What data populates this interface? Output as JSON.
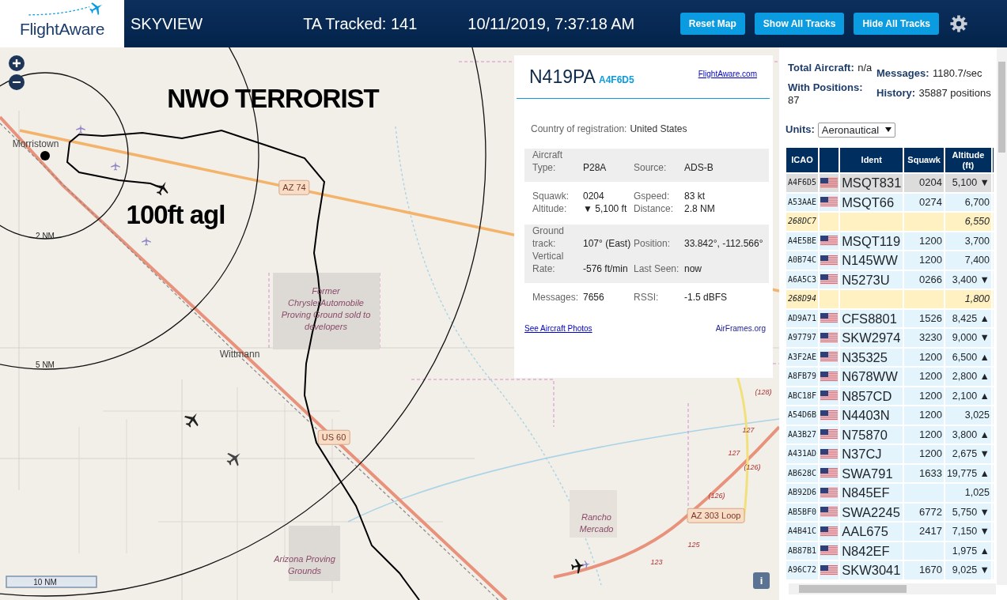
{
  "header": {
    "logo": "FlightAware",
    "title": "SKYVIEW",
    "tracked": "TA Tracked: 141",
    "datetime": "10/11/2019, 7:37:18 AM",
    "buttons": [
      "Reset Map",
      "Show All Tracks",
      "Hide All Tracks"
    ]
  },
  "map": {
    "labels": [
      {
        "kind": "annotation",
        "text": "NWO TERRORIST"
      },
      {
        "kind": "annotation",
        "text": "100ft agl"
      },
      {
        "kind": "place",
        "text": "Morristown"
      },
      {
        "kind": "ring",
        "text": "2 NM"
      },
      {
        "kind": "ring",
        "text": "5 NM"
      },
      {
        "kind": "shield",
        "text": "AZ 74"
      },
      {
        "kind": "area",
        "text": "Former ChryslerAutomobile Proving Ground sold to developers"
      },
      {
        "kind": "place",
        "text": "Wittmann"
      },
      {
        "kind": "shield",
        "text": "US 60"
      },
      {
        "kind": "area",
        "text": "Rancho Mercado"
      },
      {
        "kind": "shield",
        "text": "AZ 303 Loop"
      },
      {
        "kind": "area",
        "text": "Arizona Proving Grounds"
      },
      {
        "kind": "route",
        "text": "(128)"
      },
      {
        "kind": "route",
        "text": "127"
      },
      {
        "kind": "route",
        "text": "127"
      },
      {
        "kind": "route",
        "text": "(126)"
      },
      {
        "kind": "route",
        "text": "(126)"
      },
      {
        "kind": "route",
        "text": "125"
      },
      {
        "kind": "route",
        "text": "123"
      }
    ],
    "scale": "10 NM",
    "info_button": "i"
  },
  "info_panel": {
    "registration": "N419PA",
    "icao": "A4F6D5",
    "link": "FlightAware.com",
    "country_label": "Country of registration:",
    "country": "United States",
    "sections": [
      {
        "shaded": true,
        "rows": [
          [
            "Aircraft Type:",
            "P28A",
            "Source:",
            "ADS-B"
          ]
        ]
      },
      {
        "shaded": false,
        "rows": [
          [
            "Squawk:",
            "0204",
            "Gspeed:",
            "83 kt"
          ],
          [
            "Altitude:",
            "▼ 5,100 ft",
            "Distance:",
            "2.8 NM"
          ]
        ]
      },
      {
        "shaded": true,
        "rows": [
          [
            "Ground track:",
            "107° (East)",
            "Position:",
            "33.842°, -112.566°"
          ],
          [
            "Vertical Rate:",
            "-576 ft/min",
            "Last Seen:",
            "now"
          ]
        ]
      },
      {
        "shaded": false,
        "rows": [
          [
            "Messages:",
            "7656",
            "RSSI:",
            "-1.5 dBFS"
          ]
        ]
      }
    ],
    "photos_link": "See Aircraft Photos",
    "airframes_link": "AirFrames.org"
  },
  "stats": [
    {
      "label": "Total Aircraft:",
      "value": "n/a"
    },
    {
      "label": "Messages:",
      "value": "1180.7/sec"
    },
    {
      "label": "With Positions:",
      "value": "87"
    },
    {
      "label": "History:",
      "value": "35887 positions"
    }
  ],
  "units": {
    "label": "Units:",
    "value": "Aeronautical"
  },
  "table": {
    "columns": [
      "ICAO",
      "Ident",
      "Squawk",
      "Altitude (ft)"
    ],
    "rows": [
      {
        "icao": "A4F6D5",
        "flag": true,
        "ident": "MSQT831",
        "squawk": "0204",
        "altitude": "5,100",
        "trend": "▼",
        "selected": true,
        "positioned": true
      },
      {
        "icao": "A53AAE",
        "flag": true,
        "ident": "MSQT66",
        "squawk": "0274",
        "altitude": "6,700",
        "selected": false,
        "positioned": true
      },
      {
        "icao": "268DC7",
        "flag": false,
        "altitude": "6,550",
        "selected": false,
        "positioned": false
      },
      {
        "icao": "A4E5BE",
        "flag": true,
        "ident": "MSQT119",
        "squawk": "1200",
        "altitude": "3,700",
        "selected": false,
        "positioned": true
      },
      {
        "icao": "A0B74C",
        "flag": true,
        "ident": "N145WW",
        "squawk": "1200",
        "altitude": "7,400",
        "selected": false,
        "positioned": true
      },
      {
        "icao": "A6A5C3",
        "flag": true,
        "ident": "N5273U",
        "squawk": "0266",
        "altitude": "3,400",
        "trend": "▼",
        "selected": false,
        "positioned": true
      },
      {
        "icao": "268D94",
        "flag": false,
        "altitude": "1,800",
        "selected": false,
        "positioned": false
      },
      {
        "icao": "AD9A71",
        "flag": true,
        "ident": "CFS8801",
        "squawk": "1526",
        "altitude": "8,425",
        "trend": "▲",
        "selected": false,
        "positioned": true
      },
      {
        "icao": "A97797",
        "flag": true,
        "ident": "SKW2974",
        "squawk": "3230",
        "altitude": "9,000",
        "trend": "▼",
        "selected": false,
        "positioned": true
      },
      {
        "icao": "A3F2AE",
        "flag": true,
        "ident": "N35325",
        "squawk": "1200",
        "altitude": "6,500",
        "trend": "▲",
        "selected": false,
        "positioned": true
      },
      {
        "icao": "A8FB79",
        "flag": true,
        "ident": "N678WW",
        "squawk": "1200",
        "altitude": "2,800",
        "trend": "▲",
        "selected": false,
        "positioned": true
      },
      {
        "icao": "ABC18F",
        "flag": true,
        "ident": "N857CD",
        "squawk": "1200",
        "altitude": "2,100",
        "trend": "▲",
        "selected": false,
        "positioned": true
      },
      {
        "icao": "A54D6B",
        "flag": true,
        "ident": "N4403N",
        "squawk": "1200",
        "altitude": "3,025",
        "selected": false,
        "positioned": true
      },
      {
        "icao": "AA3B27",
        "flag": true,
        "ident": "N75870",
        "squawk": "1200",
        "altitude": "3,800",
        "trend": "▲",
        "selected": false,
        "positioned": true
      },
      {
        "icao": "A431AD",
        "flag": true,
        "ident": "N37CJ",
        "squawk": "1200",
        "altitude": "2,675",
        "trend": "▼",
        "selected": false,
        "positioned": true
      },
      {
        "icao": "AB628C",
        "flag": true,
        "ident": "SWA791",
        "squawk": "1633",
        "altitude": "19,775",
        "trend": "▲",
        "selected": false,
        "positioned": true
      },
      {
        "icao": "AB92D6",
        "flag": true,
        "ident": "N845EF",
        "altitude": "1,025",
        "selected": false,
        "positioned": true
      },
      {
        "icao": "AB5BF0",
        "flag": true,
        "ident": "SWA2245",
        "squawk": "6772",
        "altitude": "5,750",
        "trend": "▼",
        "selected": false,
        "positioned": true
      },
      {
        "icao": "A4B41C",
        "flag": true,
        "ident": "AAL675",
        "squawk": "2417",
        "altitude": "7,150",
        "trend": "▼",
        "selected": false,
        "positioned": true
      },
      {
        "icao": "AB87B1",
        "flag": true,
        "ident": "N842EF",
        "altitude": "1,975",
        "trend": "▲",
        "selected": false,
        "positioned": true
      },
      {
        "icao": "A96C72",
        "flag": true,
        "ident": "SKW3041",
        "squawk": "1670",
        "altitude": "9,025",
        "trend": "▼",
        "selected": false,
        "positioned": true
      }
    ]
  }
}
